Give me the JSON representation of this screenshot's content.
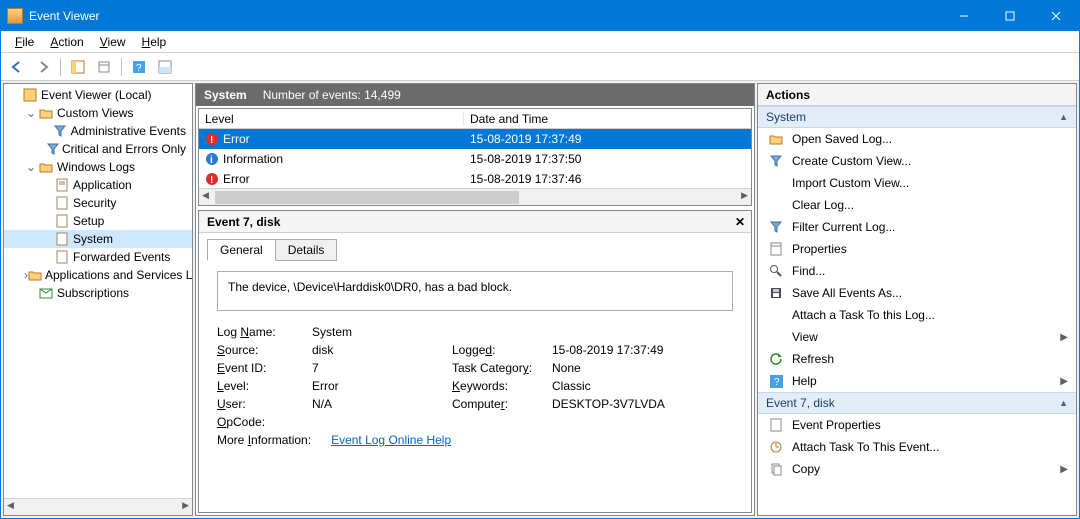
{
  "window": {
    "title": "Event Viewer"
  },
  "menu": {
    "file": "File",
    "action": "Action",
    "view": "View",
    "help": "Help"
  },
  "tree": {
    "root": "Event Viewer (Local)",
    "customViews": "Custom Views",
    "adminEvents": "Administrative Events",
    "critErrors": "Critical and Errors Only",
    "winLogs": "Windows Logs",
    "application": "Application",
    "security": "Security",
    "setup": "Setup",
    "system": "System",
    "forwarded": "Forwarded Events",
    "appsServices": "Applications and Services Lo",
    "subscriptions": "Subscriptions"
  },
  "listHeader": {
    "title": "System",
    "count_label": "Number of events: 14,499"
  },
  "columns": {
    "level": "Level",
    "date": "Date and Time"
  },
  "events": [
    {
      "level": "Error",
      "icon": "error",
      "date": "15-08-2019 17:37:49",
      "selected": true
    },
    {
      "level": "Information",
      "icon": "info",
      "date": "15-08-2019 17:37:50",
      "selected": false
    },
    {
      "level": "Error",
      "icon": "error",
      "date": "15-08-2019 17:37:46",
      "selected": false
    }
  ],
  "detail": {
    "title": "Event 7, disk",
    "tab_general": "General",
    "tab_details": "Details",
    "description": "The device, \\Device\\Harddisk0\\DR0, has a bad block.",
    "fields": {
      "logname_l": "Log Name:",
      "logname_v": "System",
      "source_l": "Source:",
      "source_v": "disk",
      "logged_l": "Logged:",
      "logged_v": "15-08-2019 17:37:49",
      "eventid_l": "Event ID:",
      "eventid_v": "7",
      "taskcat_l": "Task Category:",
      "taskcat_v": "None",
      "level_l": "Level:",
      "level_v": "Error",
      "keywords_l": "Keywords:",
      "keywords_v": "Classic",
      "user_l": "User:",
      "user_v": "N/A",
      "computer_l": "Computer:",
      "computer_v": "DESKTOP-3V7LVDA",
      "opcode_l": "OpCode:",
      "opcode_v": "",
      "moreinfo_l": "More Information:",
      "moreinfo_link": "Event Log Online Help"
    }
  },
  "actions": {
    "title": "Actions",
    "group1": "System",
    "open_saved": "Open Saved Log...",
    "create_view": "Create Custom View...",
    "import_view": "Import Custom View...",
    "clear_log": "Clear Log...",
    "filter_log": "Filter Current Log...",
    "properties": "Properties",
    "find": "Find...",
    "save_all": "Save All Events As...",
    "attach_task": "Attach a Task To this Log...",
    "view": "View",
    "refresh": "Refresh",
    "help": "Help",
    "group2": "Event 7, disk",
    "evt_props": "Event Properties",
    "evt_attach": "Attach Task To This Event...",
    "evt_copy": "Copy"
  }
}
